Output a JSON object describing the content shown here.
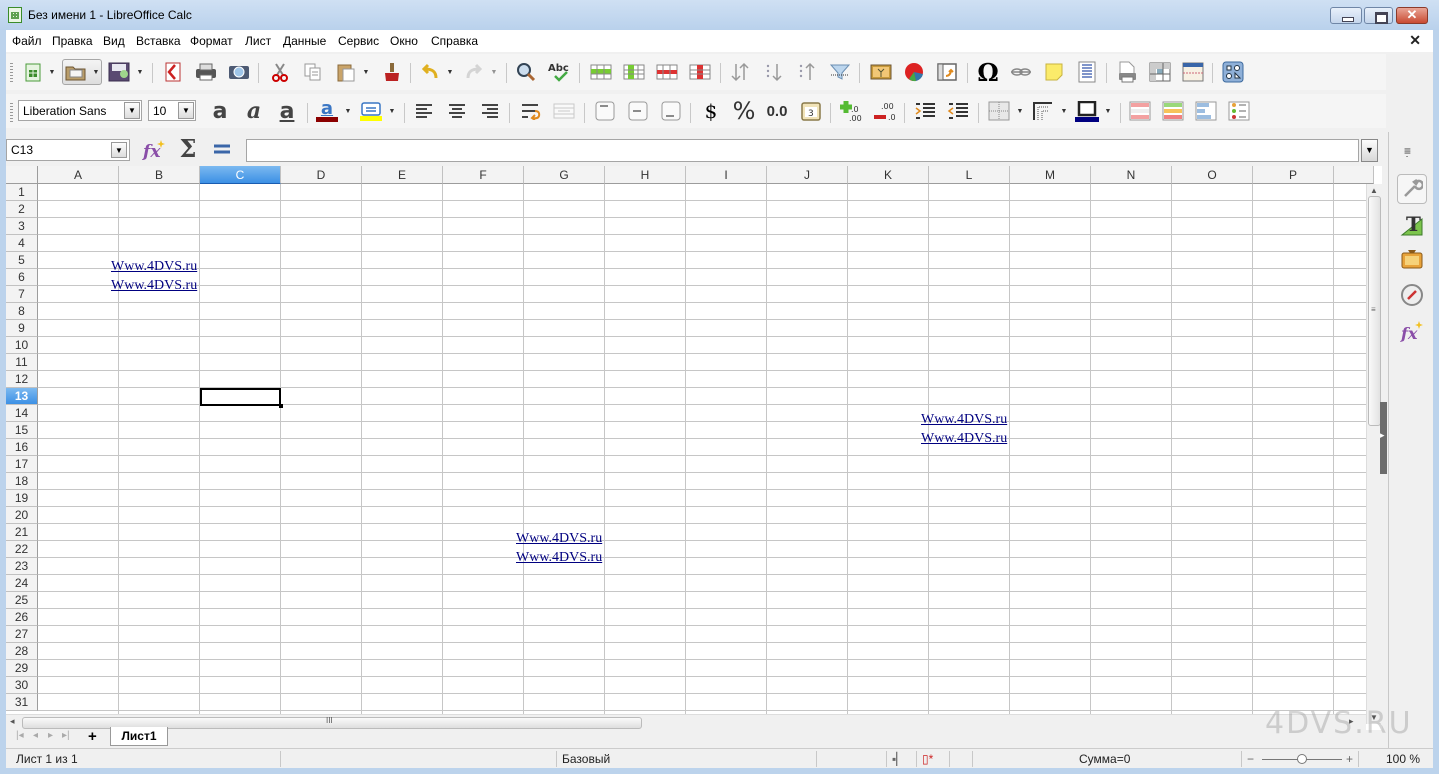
{
  "window": {
    "title": "Без имени 1 - LibreOffice Calc",
    "minimize": "minimize",
    "maximize": "maximize",
    "close": "✕"
  },
  "menubar": {
    "items": [
      "Файл",
      "Правка",
      "Вид",
      "Вставка",
      "Формат",
      "Лист",
      "Данные",
      "Сервис",
      "Окно",
      "Справка"
    ],
    "close_doc": "✕"
  },
  "toolbar_standard": {
    "icons": [
      "new-document-icon",
      "open-icon",
      "save-icon",
      "export-pdf-icon",
      "print-icon",
      "print-preview-icon",
      "cut-icon",
      "copy-icon",
      "paste-icon",
      "clone-formatting-icon",
      "undo-icon",
      "redo-icon",
      "find-replace-icon",
      "spellcheck-icon",
      "insert-row-icon",
      "insert-column-icon",
      "delete-row-icon",
      "delete-column-icon",
      "sort-icon",
      "sort-ascending-icon",
      "sort-descending-icon",
      "autofilter-icon",
      "insert-image-icon",
      "insert-chart-icon",
      "pivot-table-icon",
      "special-character-icon",
      "hyperlink-icon",
      "comment-icon",
      "headers-footers-icon",
      "define-print-area-icon",
      "freeze-rows-columns-icon",
      "split-window-icon",
      "show-draw-functions-icon"
    ]
  },
  "toolbar_formatting": {
    "font_name": "Liberation Sans",
    "font_size": "10",
    "bold": "a",
    "italic": "a",
    "underline": "a",
    "font_color": "#8b0000",
    "highlight_color": "#ffff00",
    "currency": "$",
    "percent": "%",
    "number": "0.0",
    "date": "3",
    "add_decimal": "+.0",
    "delete_decimal": "-.00",
    "border_color": "#000080"
  },
  "formula_bar": {
    "name_box": "C13",
    "formula_value": ""
  },
  "grid": {
    "columns": [
      "A",
      "B",
      "C",
      "D",
      "E",
      "F",
      "G",
      "H",
      "I",
      "J",
      "K",
      "L",
      "M",
      "N",
      "O",
      "P"
    ],
    "selected_column": "C",
    "rows": [
      "1",
      "2",
      "3",
      "4",
      "5",
      "6",
      "7",
      "8",
      "9",
      "10",
      "11",
      "12",
      "13",
      "14",
      "15",
      "16",
      "17",
      "18",
      "19",
      "20",
      "21",
      "22",
      "23",
      "24",
      "25",
      "26",
      "27",
      "28",
      "29",
      "30",
      "31"
    ],
    "selected_row": "13",
    "active_cell": "C13",
    "links": [
      {
        "text": "Www.4DVS.ru"
      },
      {
        "text": "Www.4DVS.ru"
      },
      {
        "text": "Www.4DVS.ru"
      },
      {
        "text": "Www.4DVS.ru"
      },
      {
        "text": "Www.4DVS.ru"
      },
      {
        "text": "Www.4DVS.ru"
      }
    ]
  },
  "sheet_tabs": {
    "add": "+",
    "tabs": [
      "Лист1"
    ],
    "active": "Лист1"
  },
  "status_bar": {
    "sheet_info": "Лист 1 из 1",
    "page_style": "Базовый",
    "sum": "Сумма=0",
    "zoom": "100 %",
    "zoom_minus": "−",
    "zoom_plus": "+",
    "zoom_fraction": 0.5
  },
  "sidebar": {
    "icons": [
      "sidebar-menu-icon",
      "properties-icon",
      "styles-icon",
      "gallery-icon",
      "navigator-icon",
      "functions-icon"
    ]
  },
  "watermark": "4DVS.RU"
}
